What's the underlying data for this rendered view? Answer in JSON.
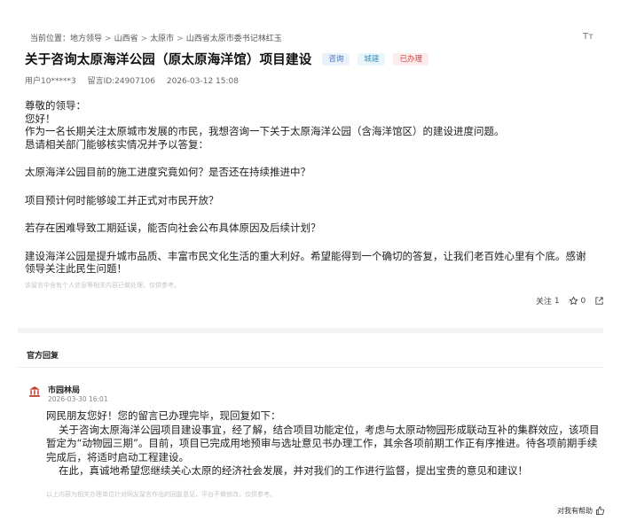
{
  "breadcrumb": {
    "prefix": "当前位置：",
    "items": [
      "地方领导",
      "山西省",
      "太原市",
      "山西省太原市委书记林红玉"
    ],
    "separator": ">"
  },
  "font_toggle": "Tт",
  "message": {
    "title": "关于咨询太原海洋公园（原太原海洋馆）项目建设",
    "tags": [
      "咨询",
      "城建",
      "已办理"
    ],
    "user": "用户10*****3",
    "message_id": "留言ID:24907106",
    "date": "2026-03-12 15:08",
    "lines": [
      "尊敬的领导：",
      "您好！",
      "作为一名长期关注太原城市发展的市民，我想咨询一下关于太原海洋公园（含海洋馆区）的建设进度问题。",
      "恳请相关部门能够核实情况并予以答复：",
      "",
      "太原海洋公园目前的施工进度究竟如何？是否还在持续推进中？",
      "",
      "项目预计何时能够竣工并正式对市民开放？",
      "",
      "若存在困难导致工期延误，能否向社会公布具体原因及后续计划？",
      "",
      "建设海洋公园是提升城市品质、丰富市民文化生活的重大利好。希望能得到一个确切的答复，让我们老百姓心里有个底。感谢领导关注此民生问题！"
    ],
    "notice": "该留言中含有个人信息等相关内容已做处理，仅供参考。",
    "follow_label": "关注",
    "follow_count": "1",
    "like_count": "0"
  },
  "reply": {
    "heading": "官方回复",
    "org": "市园林局",
    "time": "2026-03-30 16:01",
    "greeting": "网民朋友您好！您的留言已办理完毕，现回复如下：",
    "paragraphs": [
      "关于咨询太原海洋公园项目建设事宜，经了解，结合项目功能定位，考虑与太原动物园形成联动互补的集群效应，该项目暂定为“动物园三期”。目前，项目已完成用地预审与选址意见书办理工作，其余各项前期工作正有序推进。待各项前期手续完成后，将适时启动工程建设。",
      "在此，真诚地希望您继续关心太原的经济社会发展，并对我们的工作进行监督，提出宝贵的意见和建议！"
    ],
    "notice": "以上内容为相关办理单位针对网友留言作出的回复意见，平台不做修改，仅供参考。",
    "helpful_label": "对我有帮助"
  },
  "colors": {
    "tag_consult_text": "#4a72b8",
    "tag_city_text": "#3a8fb5",
    "tag_done_text": "#d04545",
    "org_icon": "#c0392b"
  }
}
